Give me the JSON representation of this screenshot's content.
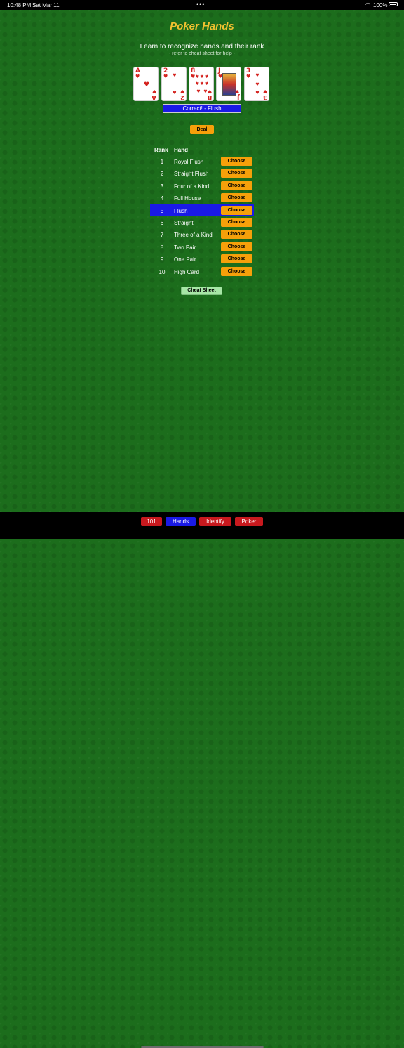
{
  "status": {
    "time": "10:48 PM",
    "date": "Sat Mar 11",
    "battery": "100%"
  },
  "header": {
    "title": "Poker Hands",
    "subtitle": "Learn to recognize hands and their rank",
    "hint": "- refer to cheat sheet for help -"
  },
  "cards": [
    {
      "rank": "A",
      "suit": "♥"
    },
    {
      "rank": "2",
      "suit": "♥"
    },
    {
      "rank": "8",
      "suit": "♥"
    },
    {
      "rank": "J",
      "suit": "♥"
    },
    {
      "rank": "3",
      "suit": "♥"
    }
  ],
  "result_text": "Correct! - Flush",
  "deal_label": "Deal",
  "table": {
    "rank_header": "Rank",
    "hand_header": "Hand",
    "choose_label": "Choose",
    "selected_index": 4,
    "rows": [
      {
        "rank": "1",
        "hand": "Royal Flush"
      },
      {
        "rank": "2",
        "hand": "Straight Flush"
      },
      {
        "rank": "3",
        "hand": "Four of a Kind"
      },
      {
        "rank": "4",
        "hand": "Full House"
      },
      {
        "rank": "5",
        "hand": "Flush"
      },
      {
        "rank": "6",
        "hand": "Straight"
      },
      {
        "rank": "7",
        "hand": "Three of a Kind"
      },
      {
        "rank": "8",
        "hand": "Two Pair"
      },
      {
        "rank": "9",
        "hand": "One Pair"
      },
      {
        "rank": "10",
        "hand": "High Card"
      }
    ]
  },
  "cheat_sheet_label": "Cheat Sheet",
  "tabs": [
    {
      "label": "101",
      "color": "#c8191e"
    },
    {
      "label": "Hands",
      "color": "#1a1ae6"
    },
    {
      "label": "Identify",
      "color": "#c8191e"
    },
    {
      "label": "Poker",
      "color": "#c8191e"
    }
  ],
  "colors": {
    "felt": "#1c6d1c",
    "title": "#f2c230",
    "button": "#f6a00a",
    "selected": "#1a1ae6",
    "card_red": "#d4221e"
  }
}
